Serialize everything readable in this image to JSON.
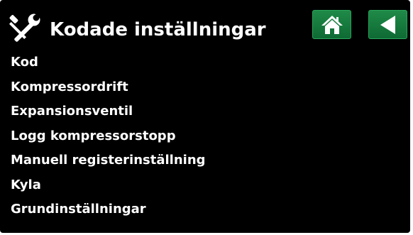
{
  "header": {
    "icon": "tools-icon",
    "title": "Kodade inställningar"
  },
  "nav": {
    "home_icon": "home-icon",
    "back_icon": "back-arrow-icon",
    "button_color": "#177a3e"
  },
  "menu": {
    "items": [
      {
        "label": "Kod"
      },
      {
        "label": "Kompressordrift"
      },
      {
        "label": "Expansionsventil"
      },
      {
        "label": "Logg kompressorstopp"
      },
      {
        "label": "Manuell registerinställning"
      },
      {
        "label": "Kyla"
      },
      {
        "label": "Grundinställningar"
      }
    ]
  },
  "colors": {
    "background": "#000000",
    "text": "#ffffff",
    "accent": "#177a3e"
  }
}
